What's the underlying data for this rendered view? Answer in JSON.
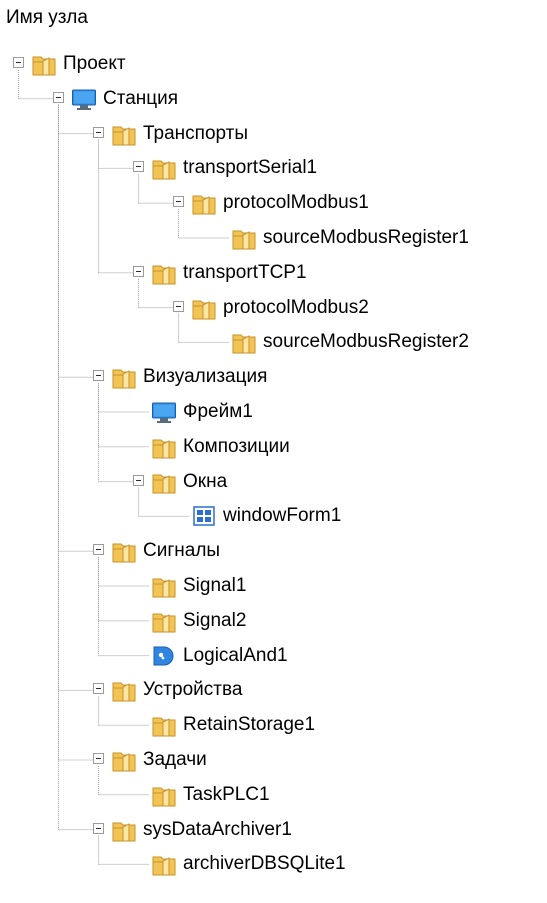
{
  "tree": {
    "header": "Имя узла",
    "nodes": [
      {
        "label": "Проект",
        "icon": "folder-icon",
        "level": 0,
        "expanded": true
      },
      {
        "label": "Станция",
        "icon": "monitor-icon",
        "level": 1,
        "expanded": true
      },
      {
        "label": "Транспорты",
        "icon": "folder-icon",
        "level": 2,
        "expanded": true
      },
      {
        "label": "transportSerial1",
        "icon": "folder-icon",
        "level": 3,
        "expanded": true
      },
      {
        "label": "protocolModbus1",
        "icon": "folder-icon",
        "level": 4,
        "expanded": true
      },
      {
        "label": "sourceModbusRegister1",
        "icon": "folder-icon",
        "level": 5,
        "expanded": false
      },
      {
        "label": "transportTCP1",
        "icon": "folder-icon",
        "level": 3,
        "expanded": true
      },
      {
        "label": "protocolModbus2",
        "icon": "folder-icon",
        "level": 4,
        "expanded": true
      },
      {
        "label": "sourceModbusRegister2",
        "icon": "folder-icon",
        "level": 5,
        "expanded": false
      },
      {
        "label": "Визуализация",
        "icon": "folder-icon",
        "level": 2,
        "expanded": true
      },
      {
        "label": "Фрейм1",
        "icon": "monitor-icon",
        "level": 3,
        "expanded": false
      },
      {
        "label": "Композиции",
        "icon": "folder-icon",
        "level": 3,
        "expanded": false
      },
      {
        "label": "Окна",
        "icon": "folder-icon",
        "level": 3,
        "expanded": true
      },
      {
        "label": "windowForm1",
        "icon": "window-grid-icon",
        "level": 4,
        "expanded": false
      },
      {
        "label": "Сигналы",
        "icon": "folder-icon",
        "level": 2,
        "expanded": true
      },
      {
        "label": "Signal1",
        "icon": "folder-icon",
        "level": 3,
        "expanded": false
      },
      {
        "label": "Signal2",
        "icon": "folder-icon",
        "level": 3,
        "expanded": false
      },
      {
        "label": "LogicalAnd1",
        "icon": "logic-gate-icon",
        "level": 3,
        "expanded": false
      },
      {
        "label": "Устройства",
        "icon": "folder-icon",
        "level": 2,
        "expanded": true
      },
      {
        "label": "RetainStorage1",
        "icon": "folder-icon",
        "level": 3,
        "expanded": false
      },
      {
        "label": "Задачи",
        "icon": "folder-icon",
        "level": 2,
        "expanded": true
      },
      {
        "label": "TaskPLC1",
        "icon": "folder-icon",
        "level": 3,
        "expanded": false
      },
      {
        "label": "sysDataArchiver1",
        "icon": "folder-icon",
        "level": 2,
        "expanded": true
      },
      {
        "label": "archiverDBSQLite1",
        "icon": "folder-icon",
        "level": 3,
        "expanded": false
      }
    ]
  },
  "colors": {
    "folder": "#f2c453",
    "folder_dark": "#c8922a",
    "monitor_screen": "#2f8fe8",
    "grid_icon": "#2c6fd1",
    "gate_icon": "#2f86e0",
    "tree_line": "#a0a0a0"
  }
}
